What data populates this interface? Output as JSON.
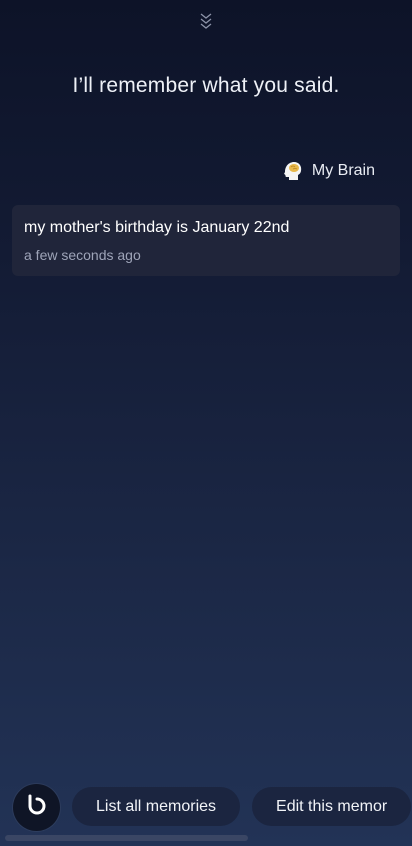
{
  "header": {
    "collapse_icon": "double-chevron-down-icon",
    "headline": "I’ll remember what you said."
  },
  "brain_link": {
    "icon": "brain-head-icon",
    "label": "My Brain"
  },
  "memory": {
    "text": "my mother's birthday is January 22nd",
    "timestamp": "a few seconds ago"
  },
  "bottom_bar": {
    "assistant_icon": "bixby-icon",
    "suggestions": [
      {
        "label": "List all memories"
      },
      {
        "label": "Edit this memor"
      }
    ]
  },
  "colors": {
    "background_top": "#0d1328",
    "background_bottom": "#223356",
    "card": "#20253a",
    "chip": "#1b2540",
    "brain_accent": "#e8b84a"
  }
}
